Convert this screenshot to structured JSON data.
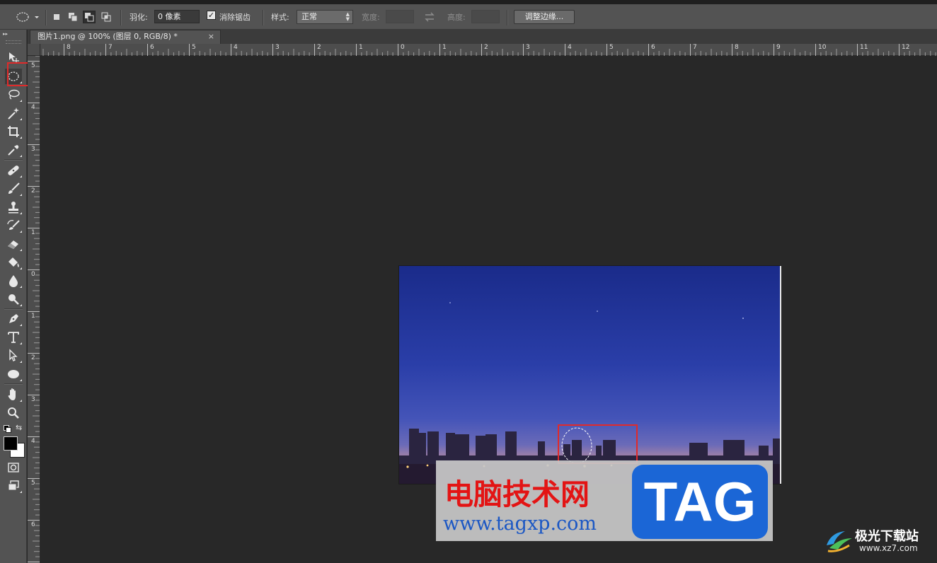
{
  "options_bar": {
    "feather_label": "羽化:",
    "feather_value": "0 像素",
    "antialias_label": "消除锯齿",
    "antialias_checked": true,
    "style_label": "样式:",
    "style_value": "正常",
    "width_label": "宽度:",
    "height_label": "高度:",
    "refine_edge_label": "调整边缘..."
  },
  "document_tab": {
    "title": "图片1.png @ 100% (图层 0, RGB/8) *",
    "close_glyph": "×"
  },
  "rulers": {
    "horizontal": [
      "8",
      "7",
      "6",
      "5",
      "4",
      "3",
      "2",
      "1",
      "0",
      "1",
      "2",
      "3",
      "4",
      "5",
      "6",
      "7",
      "8",
      "9",
      "10",
      "11",
      "12"
    ],
    "vertical": [
      "5",
      "4",
      "3",
      "2",
      "1",
      "0",
      "1",
      "2",
      "3",
      "4",
      "5",
      "6"
    ]
  },
  "tools": [
    {
      "name": "move-tool-icon"
    },
    {
      "name": "elliptical-marquee-tool-icon",
      "selected": true
    },
    {
      "name": "lasso-tool-icon"
    },
    {
      "name": "magic-wand-tool-icon"
    },
    {
      "name": "crop-tool-icon"
    },
    {
      "name": "eyedropper-tool-icon"
    },
    {
      "name": "healing-brush-tool-icon"
    },
    {
      "name": "brush-tool-icon"
    },
    {
      "name": "clone-stamp-tool-icon"
    },
    {
      "name": "history-brush-tool-icon"
    },
    {
      "name": "eraser-tool-icon"
    },
    {
      "name": "paint-bucket-tool-icon"
    },
    {
      "name": "blur-tool-icon"
    },
    {
      "name": "dodge-tool-icon"
    },
    {
      "name": "pen-tool-icon"
    },
    {
      "name": "type-tool-icon"
    },
    {
      "name": "path-selection-tool-icon"
    },
    {
      "name": "ellipse-shape-tool-icon"
    },
    {
      "name": "hand-tool-icon"
    },
    {
      "name": "zoom-tool-icon"
    }
  ],
  "colors": {
    "foreground": "#000000",
    "background": "#ffffff",
    "highlight": "#e02a2a"
  },
  "watermark": {
    "chinese": "电脑技术网",
    "url": "www.tagxp.com",
    "tag": "TAG"
  },
  "site_badge": {
    "chinese": "极光下载站",
    "url": "www.xz7.com"
  }
}
